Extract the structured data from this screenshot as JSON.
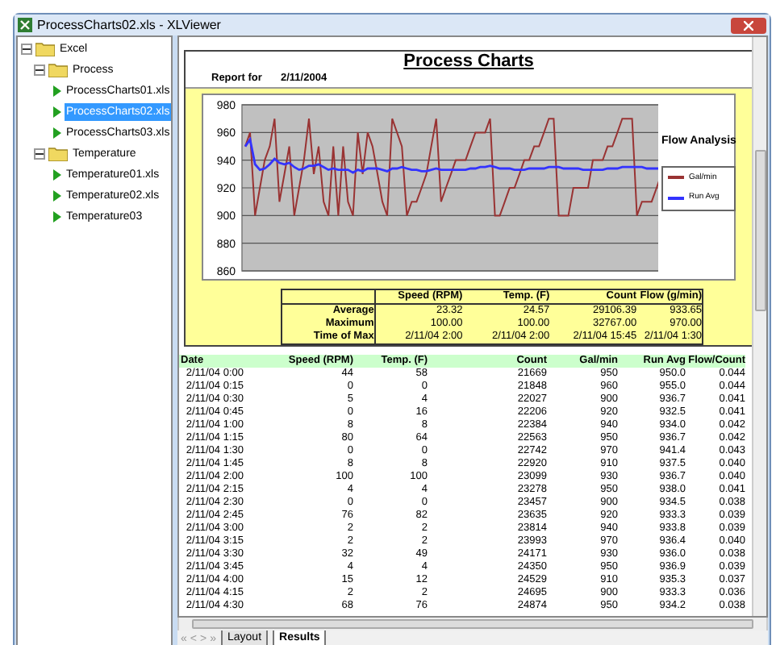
{
  "window": {
    "title": "ProcessCharts02.xls - XLViewer"
  },
  "tree": [
    {
      "label": "Excel",
      "kind": "folder",
      "expanded": true,
      "children": [
        {
          "label": "Process",
          "kind": "folder",
          "expanded": true,
          "children": [
            {
              "label": "ProcessCharts01.xls",
              "kind": "file",
              "selected": false
            },
            {
              "label": "ProcessCharts02.xls",
              "kind": "file",
              "selected": true
            },
            {
              "label": "ProcessCharts03.xls",
              "kind": "file",
              "selected": false
            }
          ]
        },
        {
          "label": "Temperature",
          "kind": "folder",
          "expanded": true,
          "children": [
            {
              "label": "Temperature01.xls",
              "kind": "file",
              "selected": false
            },
            {
              "label": "Temperature02.xls",
              "kind": "file",
              "selected": false
            },
            {
              "label": "Temperature03",
              "kind": "file",
              "selected": false
            }
          ]
        }
      ]
    }
  ],
  "sheet": {
    "title": "Process Charts",
    "report_label": "Report for",
    "report_date": "2/11/2004",
    "chart": {
      "chart_data": {
        "type": "line",
        "title": "Flow Analysis",
        "ylim": [
          860,
          980
        ],
        "yticks": [
          860,
          880,
          900,
          920,
          940,
          960,
          980
        ],
        "series": [
          {
            "name": "Gal/min",
            "color": "#993333",
            "values": [
              950,
              960,
              900,
              920,
              940,
              950,
              970,
              910,
              930,
              950,
              900,
              920,
              940,
              970,
              930,
              950,
              910,
              900,
              950,
              900,
              950,
              910,
              900,
              960,
              930,
              960,
              950,
              930,
              910,
              900,
              970,
              960,
              950,
              900,
              910,
              910,
              920,
              930,
              950,
              970,
              910,
              920,
              930,
              940,
              940,
              940,
              950,
              960,
              960,
              960,
              970,
              900,
              900,
              910,
              920,
              920,
              930,
              940,
              940,
              950,
              950,
              960,
              970,
              970,
              900,
              900,
              900,
              920,
              920,
              920,
              920,
              940,
              940,
              940,
              950,
              950,
              960,
              970,
              970,
              970,
              900,
              910,
              910,
              910,
              920,
              930
            ]
          },
          {
            "name": "Run Avg",
            "color": "#3333ff",
            "values": [
              950,
              955,
              937,
              933,
              934,
              937,
              941,
              938,
              937,
              938,
              935,
              933,
              934,
              936,
              936,
              937,
              935,
              933,
              934,
              933,
              933,
              933,
              931,
              933,
              932,
              934,
              934,
              934,
              933,
              932,
              934,
              934,
              935,
              934,
              933,
              933,
              932,
              932,
              933,
              934,
              933,
              933,
              933,
              933,
              933,
              933,
              934,
              934,
              935,
              935,
              936,
              935,
              934,
              934,
              934,
              933,
              933,
              933,
              934,
              934,
              934,
              934,
              935,
              935,
              935,
              934,
              934,
              934,
              934,
              933,
              933,
              933,
              933,
              933,
              934,
              934,
              934,
              935,
              935,
              935,
              935,
              935,
              934,
              934,
              934,
              934
            ]
          }
        ],
        "grid": true,
        "legend": true
      }
    },
    "summary": {
      "columns": [
        "Speed (RPM)",
        "Temp. (F)",
        "Count",
        "Flow (g/min)"
      ],
      "rows": [
        {
          "label": "Average",
          "cells": [
            "23.32",
            "24.57",
            "29106.39",
            "933.65"
          ]
        },
        {
          "label": "Maximum",
          "cells": [
            "100.00",
            "100.00",
            "32767.00",
            "970.00"
          ]
        },
        {
          "label": "Time of Max",
          "cells": [
            "2/11/04 2:00",
            "2/11/04 2:00",
            "2/11/04 15:45",
            "2/11/04 1:30"
          ]
        }
      ]
    },
    "data": {
      "columns": [
        "Date",
        "Speed (RPM)",
        "Temp. (F)",
        "Count",
        "Gal/min",
        "Run Avg",
        "Flow/Count"
      ],
      "rows": [
        [
          "2/11/04 0:00",
          "44",
          "58",
          "21669",
          "950",
          "950.0",
          "0.044"
        ],
        [
          "2/11/04 0:15",
          "0",
          "0",
          "21848",
          "960",
          "955.0",
          "0.044"
        ],
        [
          "2/11/04 0:30",
          "5",
          "4",
          "22027",
          "900",
          "936.7",
          "0.041"
        ],
        [
          "2/11/04 0:45",
          "0",
          "16",
          "22206",
          "920",
          "932.5",
          "0.041"
        ],
        [
          "2/11/04 1:00",
          "8",
          "8",
          "22384",
          "940",
          "934.0",
          "0.042"
        ],
        [
          "2/11/04 1:15",
          "80",
          "64",
          "22563",
          "950",
          "936.7",
          "0.042"
        ],
        [
          "2/11/04 1:30",
          "0",
          "0",
          "22742",
          "970",
          "941.4",
          "0.043"
        ],
        [
          "2/11/04 1:45",
          "8",
          "8",
          "22920",
          "910",
          "937.5",
          "0.040"
        ],
        [
          "2/11/04 2:00",
          "100",
          "100",
          "23099",
          "930",
          "936.7",
          "0.040"
        ],
        [
          "2/11/04 2:15",
          "4",
          "4",
          "23278",
          "950",
          "938.0",
          "0.041"
        ],
        [
          "2/11/04 2:30",
          "0",
          "0",
          "23457",
          "900",
          "934.5",
          "0.038"
        ],
        [
          "2/11/04 2:45",
          "76",
          "82",
          "23635",
          "920",
          "933.3",
          "0.039"
        ],
        [
          "2/11/04 3:00",
          "2",
          "2",
          "23814",
          "940",
          "933.8",
          "0.039"
        ],
        [
          "2/11/04 3:15",
          "2",
          "2",
          "23993",
          "970",
          "936.4",
          "0.040"
        ],
        [
          "2/11/04 3:30",
          "32",
          "49",
          "24171",
          "930",
          "936.0",
          "0.038"
        ],
        [
          "2/11/04 3:45",
          "4",
          "4",
          "24350",
          "950",
          "936.9",
          "0.039"
        ],
        [
          "2/11/04 4:00",
          "15",
          "12",
          "24529",
          "910",
          "935.3",
          "0.037"
        ],
        [
          "2/11/04 4:15",
          "2",
          "2",
          "24695",
          "900",
          "933.3",
          "0.036"
        ],
        [
          "2/11/04 4:30",
          "68",
          "76",
          "24874",
          "950",
          "934.2",
          "0.038"
        ]
      ]
    }
  },
  "nav": [
    "«",
    "<",
    ">",
    "»"
  ],
  "tabs": [
    {
      "label": "Layout",
      "selected": false
    },
    {
      "label": "Results",
      "selected": true
    }
  ]
}
